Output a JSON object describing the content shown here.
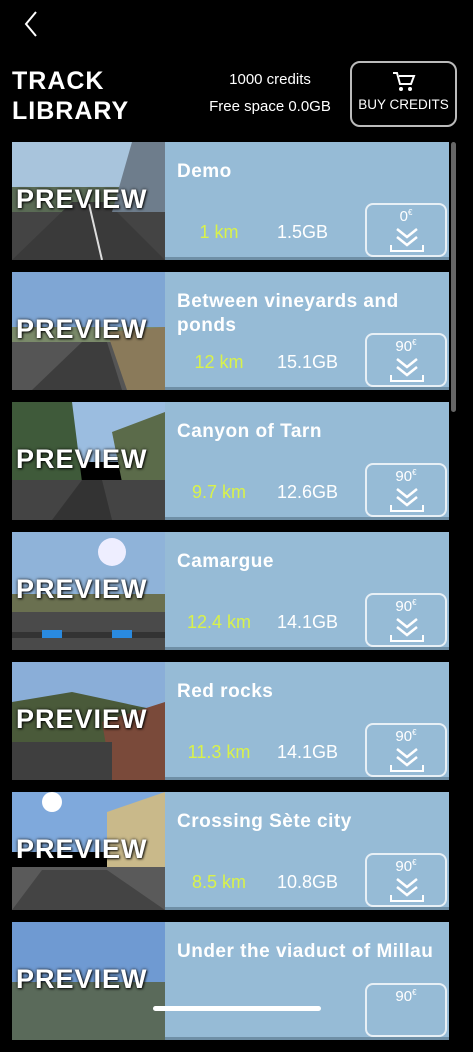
{
  "header": {
    "title_line1": "TRACK",
    "title_line2": "LIBRARY",
    "credits": "1000 credits",
    "free_space": "Free space 0.0GB",
    "buy_label": "BUY CREDITS"
  },
  "preview_label": "PREVIEW",
  "tracks": [
    {
      "name": "Demo",
      "distance": "1 km",
      "size": "1.5GB",
      "price": "0"
    },
    {
      "name": "Between vineyards and ponds",
      "distance": "12 km",
      "size": "15.1GB",
      "price": "90"
    },
    {
      "name": "Canyon of Tarn",
      "distance": "9.7 km",
      "size": "12.6GB",
      "price": "90"
    },
    {
      "name": "Camargue",
      "distance": "12.4 km",
      "size": "14.1GB",
      "price": "90"
    },
    {
      "name": "Red rocks",
      "distance": "11.3 km",
      "size": "14.1GB",
      "price": "90"
    },
    {
      "name": "Crossing Sète city",
      "distance": "8.5 km",
      "size": "10.8GB",
      "price": "90"
    },
    {
      "name": "Under the viaduct of Millau",
      "distance": "",
      "size": "",
      "price": "90"
    }
  ],
  "colors": {
    "card": "#96bbd6",
    "distance": "#d9f24a"
  }
}
